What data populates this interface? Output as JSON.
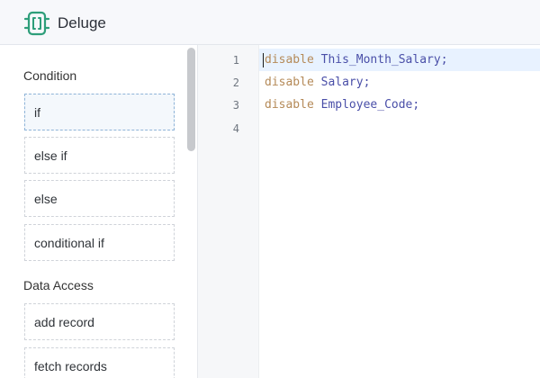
{
  "header": {
    "app_name": "Deluge",
    "logo_icon": "deluge-logo-icon",
    "accent_color": "#2e9e7a"
  },
  "sidebar": {
    "sections": [
      {
        "title": "Condition",
        "items": [
          {
            "label": "if",
            "selected": true
          },
          {
            "label": "else if"
          },
          {
            "label": "else"
          },
          {
            "label": "conditional if"
          }
        ]
      },
      {
        "title": "Data Access",
        "items": [
          {
            "label": "add record"
          },
          {
            "label": "fetch records"
          }
        ]
      }
    ]
  },
  "editor": {
    "lines": [
      {
        "number": "1",
        "keyword": "disable",
        "identifier": "This_Month_Salary",
        "terminator": ";"
      },
      {
        "number": "2",
        "keyword": "disable",
        "identifier": "Salary",
        "terminator": ";"
      },
      {
        "number": "3",
        "keyword": "disable",
        "identifier": "Employee_Code",
        "terminator": ";"
      },
      {
        "number": "4",
        "keyword": "",
        "identifier": "",
        "terminator": ""
      }
    ],
    "active_line": "1",
    "colors": {
      "keyword": "#b58a58",
      "identifier": "#4a4fa8",
      "active_line_bg": "#e8f2ff"
    }
  }
}
